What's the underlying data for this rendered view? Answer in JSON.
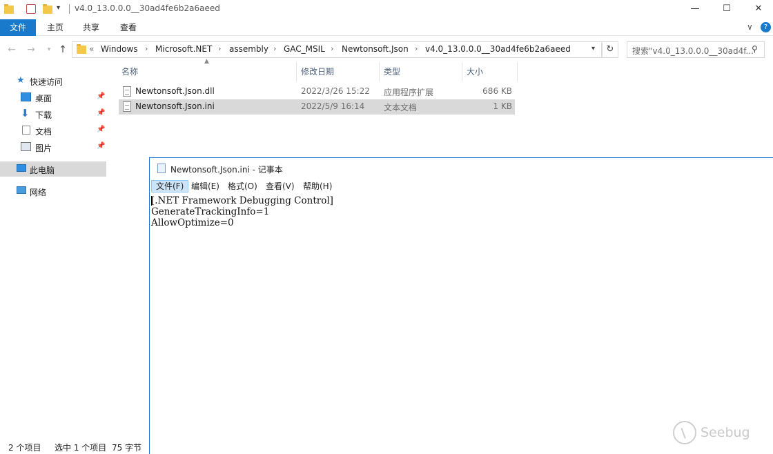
{
  "window": {
    "title": "v4.0_13.0.0.0__30ad4fe6b2a6aeed",
    "minimize_glyph": "—",
    "maximize_glyph": "☐",
    "collapse_glyph": "∨",
    "help_glyph": "?"
  },
  "ribbon": {
    "tabs": [
      "文件",
      "主页",
      "共享",
      "查看"
    ],
    "active_tab": "文件"
  },
  "address": {
    "prefix": "«",
    "crumbs": [
      "Windows",
      "Microsoft.NET",
      "assembly",
      "GAC_MSIL",
      "Newtonsoft.Json",
      "v4.0_13.0.0.0__30ad4fe6b2a6aeed"
    ],
    "separator": "›",
    "search_placeholder": "搜索\"v4.0_13.0.0.0__30ad4f..."
  },
  "sidebar": {
    "quick_access": "快速访问",
    "items": [
      {
        "label": "桌面",
        "icon": "desktop-icon",
        "pinned": true
      },
      {
        "label": "下载",
        "icon": "download-icon",
        "pinned": true
      },
      {
        "label": "文档",
        "icon": "documents-icon",
        "pinned": true
      },
      {
        "label": "图片",
        "icon": "pictures-icon",
        "pinned": true
      }
    ],
    "this_pc": "此电脑",
    "network": "网络"
  },
  "filelist": {
    "columns": [
      "名称",
      "修改日期",
      "类型",
      "大小"
    ],
    "rows": [
      {
        "name": "Newtonsoft.Json.dll",
        "modified": "2022/3/26 15:22",
        "type": "应用程序扩展",
        "size": "686 KB",
        "selected": false
      },
      {
        "name": "Newtonsoft.Json.ini",
        "modified": "2022/5/9 16:14",
        "type": "文本文档",
        "size": "1 KB",
        "selected": true
      }
    ]
  },
  "status": {
    "count": "2 个项目",
    "selected": "选中 1 个项目",
    "bytes": "75 字节"
  },
  "notepad": {
    "title": "Newtonsoft.Json.ini - 记事本",
    "menu": [
      "文件(F)",
      "编辑(E)",
      "格式(O)",
      "查看(V)",
      "帮助(H)"
    ],
    "active_menu": "文件(F)",
    "content": "[.NET Framework Debugging Control]\nGenerateTrackingInfo=1\nAllowOptimize=0"
  },
  "watermark": {
    "text": "Seebug"
  },
  "colors": {
    "accent": "#1979ca",
    "selected_row": "#d9d9d9",
    "folder": "#f4c84a",
    "notepad_border": "#1e78d4"
  }
}
